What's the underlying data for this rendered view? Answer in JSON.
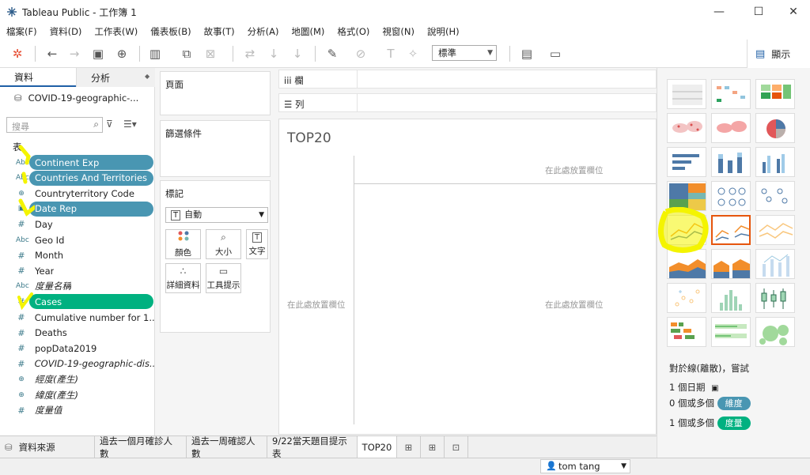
{
  "window": {
    "title": "Tableau Public - 工作簿 1",
    "controls": [
      "—",
      "☐",
      "✕"
    ]
  },
  "menu": [
    "檔案(F)",
    "資料(D)",
    "工作表(W)",
    "儀表板(B)",
    "故事(T)",
    "分析(A)",
    "地圖(M)",
    "格式(O)",
    "視窗(N)",
    "說明(H)"
  ],
  "toolbar": {
    "standard_select": "標準"
  },
  "data_pane": {
    "tabs": [
      "資料",
      "分析"
    ],
    "datasource": "COVID-19-geographic-...",
    "search_placeholder": "搜尋",
    "table_label": "表",
    "fields": [
      {
        "type": "Abc",
        "label": "Continent Exp",
        "pill": "dim"
      },
      {
        "type": "Abc",
        "label": "Countries And Territories",
        "pill": "dim"
      },
      {
        "type": "globe",
        "label": "Countryterritory Code",
        "pill": ""
      },
      {
        "type": "date",
        "label": "Date Rep",
        "pill": "dim"
      },
      {
        "type": "#",
        "label": "Day",
        "pill": ""
      },
      {
        "type": "Abc",
        "label": "Geo Id",
        "pill": ""
      },
      {
        "type": "#",
        "label": "Month",
        "pill": ""
      },
      {
        "type": "#",
        "label": "Year",
        "pill": ""
      },
      {
        "type": "Abc",
        "label": "度量名稱",
        "pill": "",
        "italic": true
      },
      {
        "type": "#",
        "label": "Cases",
        "pill": "mea"
      },
      {
        "type": "#",
        "label": "Cumulative number for 1...",
        "pill": ""
      },
      {
        "type": "#",
        "label": "Deaths",
        "pill": ""
      },
      {
        "type": "#",
        "label": "popData2019",
        "pill": ""
      },
      {
        "type": "#",
        "label": "COVID-19-geographic-dis...",
        "pill": "",
        "italic": true
      },
      {
        "type": "globe",
        "label": "經度(產生)",
        "pill": "",
        "italic": true
      },
      {
        "type": "globe",
        "label": "緯度(產生)",
        "pill": "",
        "italic": true
      },
      {
        "type": "#",
        "label": "度量值",
        "pill": "",
        "italic": true
      }
    ]
  },
  "shelves": {
    "pages": "頁面",
    "filters": "篩選條件",
    "marks": "標記",
    "mark_type": "自動",
    "mark_buttons": [
      "顏色",
      "大小",
      "文字",
      "詳細資料",
      "工具提示"
    ],
    "columns": "欄",
    "rows": "列"
  },
  "canvas": {
    "sheet_title": "TOP20",
    "drop_hint_top": "在此處放置欄位",
    "drop_hint_left": "在此處放置欄位",
    "drop_hint_center": "在此處放置欄位"
  },
  "show_me": {
    "tab_label": "顯示",
    "hint_title": "對於線(離散)，嘗試",
    "req_date": "1 個日期",
    "req_dim_prefix": "0 個或多個",
    "req_dim_badge": "維度",
    "req_mea_prefix": "1 個或多個",
    "req_mea_badge": "度量",
    "dim_color": "#4996b2",
    "mea_color": "#00b180"
  },
  "sheet_tabs": [
    "資料來源",
    "過去一個月確診人數",
    "過去一周確認人數",
    "9/22當天題目提示表",
    "TOP20"
  ],
  "status": {
    "user": "tom tang"
  }
}
